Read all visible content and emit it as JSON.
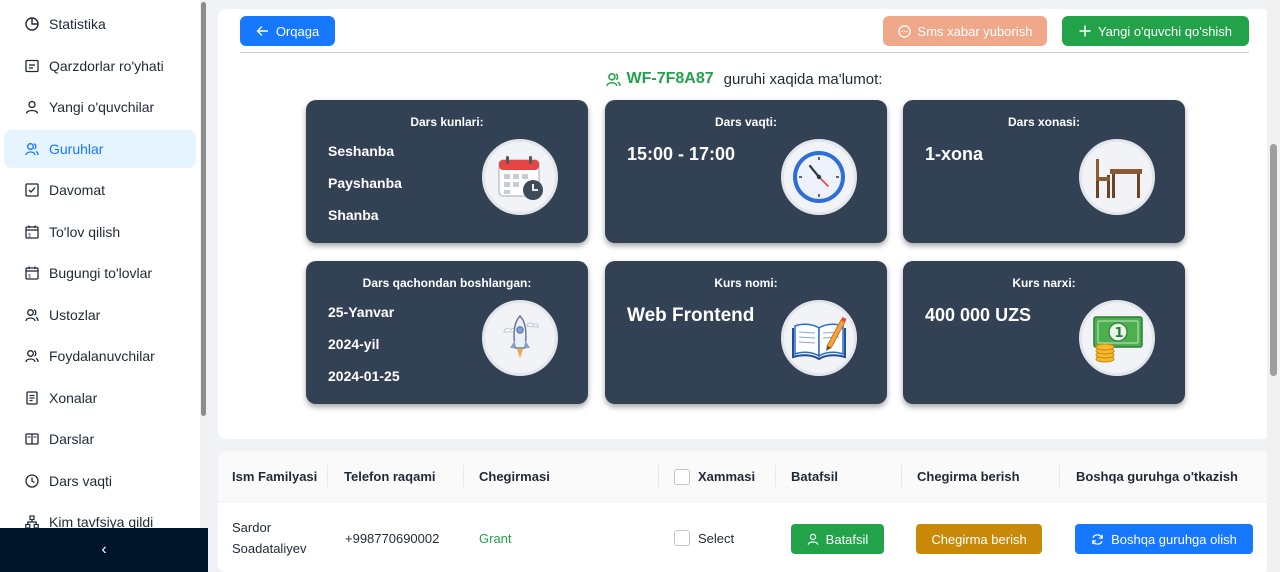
{
  "sidebar": {
    "items": [
      {
        "label": "Statistika",
        "icon": "pie-chart-icon"
      },
      {
        "label": "Qarzdorlar ro'yhati",
        "icon": "calendar-list-icon"
      },
      {
        "label": "Yangi o'quvchilar",
        "icon": "user-icon"
      },
      {
        "label": "Guruhlar",
        "icon": "team-icon",
        "active": true
      },
      {
        "label": "Davomat",
        "icon": "check-square-icon"
      },
      {
        "label": "To'lov qilish",
        "icon": "payment-calendar-icon"
      },
      {
        "label": "Bugungi to'lovlar",
        "icon": "payment-calendar-icon"
      },
      {
        "label": "Ustozlar",
        "icon": "team-icon"
      },
      {
        "label": "Foydalanuvchilar",
        "icon": "team-icon"
      },
      {
        "label": "Xonalar",
        "icon": "file-text-icon"
      },
      {
        "label": "Darslar",
        "icon": "book-icon"
      },
      {
        "label": "Dars vaqti",
        "icon": "clock-icon"
      },
      {
        "label": "Kim tavfsiya qildi",
        "icon": "cluster-icon"
      }
    ],
    "collapse_glyph": "‹"
  },
  "toolbar": {
    "back_label": "Orqaga",
    "sms_label": "Sms xabar yuborish",
    "add_label": "Yangi o'quvchi qo'shish"
  },
  "group": {
    "name": "WF-7F8A87",
    "suffix": "guruhi xaqida ma'lumot:"
  },
  "cards": {
    "days": {
      "title": "Dars kunlari:",
      "lines": [
        "Seshanba",
        "Payshanba",
        "Shanba"
      ]
    },
    "time": {
      "title": "Dars vaqti:",
      "value": "15:00 - 17:00"
    },
    "room": {
      "title": "Dars xonasi:",
      "value": "1-xona"
    },
    "start": {
      "title": "Dars qachondan boshlangan:",
      "lines": [
        "25-Yanvar",
        "2024-yil",
        "2024-01-25"
      ]
    },
    "course": {
      "title": "Kurs nomi:",
      "value": "Web Frontend"
    },
    "price": {
      "title": "Kurs narxi:",
      "value": "400 000 UZS"
    }
  },
  "table": {
    "headers": {
      "name": "Ism Familyasi",
      "phone": "Telefon raqami",
      "discount": "Chegirmasi",
      "all": "Xammasi",
      "details": "Batafsil",
      "give_discount": "Chegirma berish",
      "transfer": "Boshqa guruhga o'tkazish"
    },
    "rows": [
      {
        "name_first": "Sardor",
        "name_last": "Soadataliyev",
        "phone": "+998770690002",
        "discount": "Grant",
        "select_label": "Select",
        "details_btn": "Batafsil",
        "discount_btn": "Chegirma berish",
        "transfer_btn": "Boshqa guruhga olish"
      }
    ]
  },
  "colors": {
    "primary": "#1677ff",
    "success": "#22a34a",
    "warning": "#c98a0a",
    "sms": "#f0a88a",
    "card_bg": "#334155",
    "sidebar_footer": "#001529"
  }
}
